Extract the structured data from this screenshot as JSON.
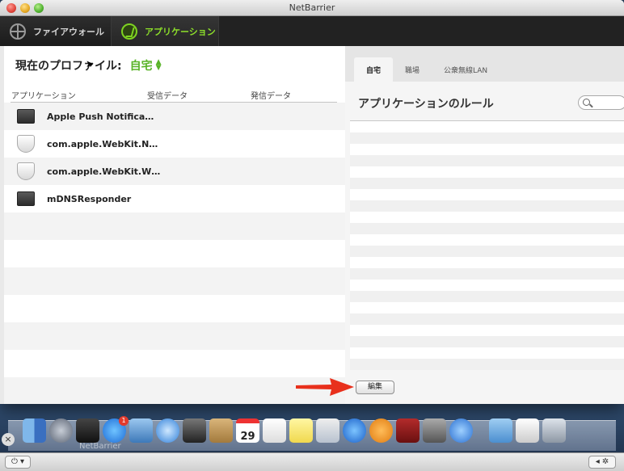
{
  "window": {
    "title": "NetBarrier"
  },
  "toolbar": {
    "firewall_label": "ファイアウォール",
    "applications_label": "アプリケーション"
  },
  "left": {
    "profile_label": "現在のプロファイル:",
    "profile_value": "自宅",
    "columns": [
      "アプリケーション",
      "受信データ",
      "発信データ"
    ],
    "rows": [
      {
        "name": "Apple Push Notifica…",
        "icon": "dark-app-icon"
      },
      {
        "name": "com.apple.WebKit.N…",
        "icon": "shield-icon"
      },
      {
        "name": "com.apple.WebKit.W…",
        "icon": "shield-icon"
      },
      {
        "name": "mDNSResponder",
        "icon": "dark-app-icon"
      }
    ]
  },
  "right": {
    "tabs": [
      "自宅",
      "職場",
      "公衆無線LAN"
    ],
    "active_tab": "自宅",
    "rules_title": "アプリケーションのルール",
    "search_placeholder": "",
    "edit_button": "編集"
  },
  "dock": {
    "ghost_label": "NetBarrier",
    "calendar_day": "29",
    "app_store_badge": "1"
  },
  "colors": {
    "accent_green": "#58b327",
    "toolbar_bg": "#222222",
    "arrow_red": "#e8301c"
  }
}
